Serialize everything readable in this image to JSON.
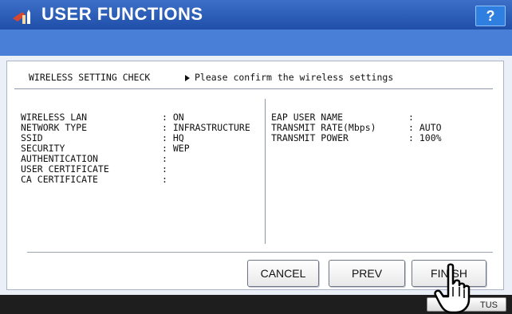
{
  "title": "USER FUNCTIONS",
  "help_label": "?",
  "header": {
    "section": "WIRELESS SETTING CHECK",
    "message": "Please confirm the wireless settings"
  },
  "left_settings": [
    {
      "label": "WIRELESS LAN",
      "value": ": ON"
    },
    {
      "label": "NETWORK TYPE",
      "value": ": INFRASTRUCTURE"
    },
    {
      "label": "SSID",
      "value": ": HQ"
    },
    {
      "label": "SECURITY",
      "value": ": WEP"
    },
    {
      "label": "AUTHENTICATION",
      "value": ":"
    },
    {
      "label": "USER CERTIFICATE",
      "value": ":"
    },
    {
      "label": "CA CERTIFICATE",
      "value": ":"
    }
  ],
  "right_settings": [
    {
      "label": "EAP USER NAME",
      "value": ":"
    },
    {
      "label": "TRANSMIT RATE(Mbps)",
      "value": ": AUTO"
    },
    {
      "label": "TRANSMIT POWER",
      "value": ": 100%"
    }
  ],
  "buttons": {
    "cancel": "CANCEL",
    "prev": "PREV",
    "finish": "FINISH"
  },
  "footer": {
    "status": "TUS"
  }
}
